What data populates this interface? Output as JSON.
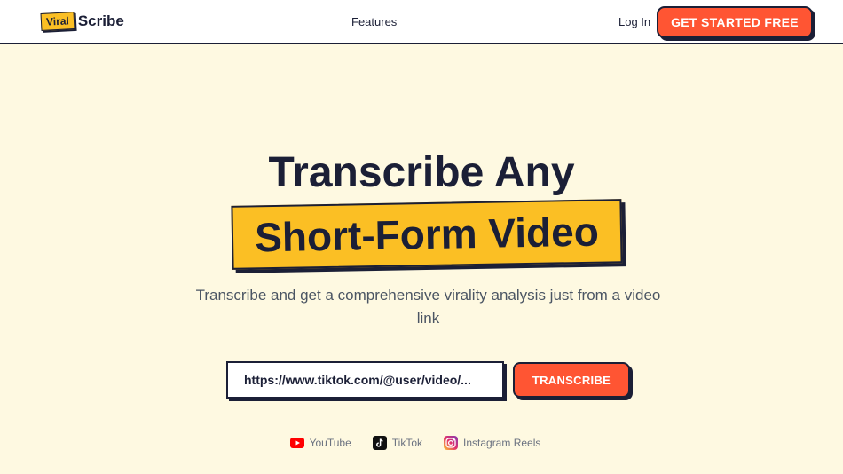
{
  "header": {
    "logo_badge": "Viral",
    "logo_text": "Scribe",
    "nav_features": "Features",
    "login": "Log In",
    "cta": "GET STARTED FREE"
  },
  "hero": {
    "title_line1": "Transcribe Any",
    "title_line2": "Short-Form Video",
    "subtitle": "Transcribe and get a comprehensive virality analysis just from a video link"
  },
  "form": {
    "url_placeholder": "https://www.tiktok.com/@user/video/...",
    "submit_label": "TRANSCRIBE"
  },
  "platforms": [
    {
      "label": "YouTube",
      "icon": "youtube-icon"
    },
    {
      "label": "TikTok",
      "icon": "tiktok-icon"
    },
    {
      "label": "Instagram Reels",
      "icon": "instagram-icon"
    }
  ],
  "colors": {
    "background": "#fef9e1",
    "accent": "#ff5533",
    "highlight": "#fbbf24",
    "ink": "#1b1f36"
  }
}
